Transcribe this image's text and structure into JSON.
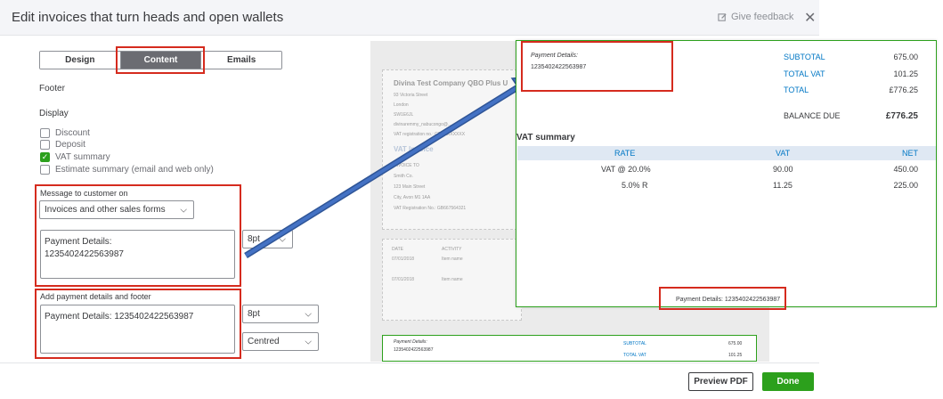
{
  "dialog": {
    "title": "Edit invoices that turn heads and open wallets",
    "feedback_label": "Give feedback",
    "close_glyph": "✕"
  },
  "tabs": [
    {
      "label": "Design",
      "active": false
    },
    {
      "label": "Content",
      "active": true
    },
    {
      "label": "Emails",
      "active": false
    }
  ],
  "sections": {
    "footer": "Footer",
    "display": "Display"
  },
  "display_options": [
    {
      "label": "Discount",
      "checked": false
    },
    {
      "label": "Deposit",
      "checked": false
    },
    {
      "label": "VAT summary",
      "checked": true
    },
    {
      "label": "Estimate summary (email and web only)",
      "checked": false
    }
  ],
  "message": {
    "heading": "Message to customer on",
    "dropdown_value": "Invoices and other sales forms",
    "text": "Payment Details:\n1235402422563987",
    "font_size": "8pt"
  },
  "payment_footer": {
    "heading": "Add payment details and footer",
    "text": "Payment Details: 1235402422563987",
    "font_size": "8pt",
    "alignment": "Centred"
  },
  "preview": {
    "company": "Divina Test Company QBO Plus U",
    "address_lines": [
      "93 Victoria Street",
      "London",
      "SW1E6JL",
      "divinaremmy_nabucongo@...",
      "VAT registration no.: GBXXXXXXXX"
    ],
    "vat_invoice": "VAT Invoice",
    "invoice_to_label": "INVOICE TO",
    "invoice_to_lines": [
      "Smith Co.",
      "123 Main Street",
      "City, Avon M1 1AA",
      "VAT Registration No.: GB667564321"
    ],
    "table_headers": [
      "DATE",
      "ACTIVITY"
    ],
    "table_rows": [
      {
        "date": "07/01/2018",
        "activity": "Item name"
      },
      {
        "date": "07/01/2018",
        "activity": "Item name"
      }
    ],
    "mini_payment_label": "Payment Details:",
    "mini_payment_number": "1235402422563987",
    "mini_subtotal_label": "SUBTOTAL",
    "mini_subtotal": "675.00",
    "mini_total_vat_label": "TOTAL VAT",
    "mini_total_vat": "101.25"
  },
  "zoom": {
    "payment_label": "Payment Details:",
    "payment_number": "1235402422563987",
    "subtotal_label": "SUBTOTAL",
    "subtotal": "675.00",
    "total_vat_label": "TOTAL VAT",
    "total_vat": "101.25",
    "total_label": "TOTAL",
    "total": "£776.25",
    "balance_label": "BALANCE DUE",
    "balance": "£776.25",
    "vat_summary_title": "VAT summary",
    "vat_headers": [
      "RATE",
      "VAT",
      "NET"
    ],
    "vat_rows": [
      {
        "rate": "VAT @ 20.0%",
        "vat": "90.00",
        "net": "450.00"
      },
      {
        "rate": "5.0% R",
        "vat": "11.25",
        "net": "225.00"
      }
    ],
    "footer_text": "Payment Details: 1235402422563987"
  },
  "actions": {
    "preview_pdf": "Preview PDF",
    "done": "Done"
  },
  "colors": {
    "accent_green": "#2ca01c",
    "annotation_red": "#d52b1e",
    "link_blue": "#0077c5",
    "arrow_blue": "#2f5597"
  }
}
